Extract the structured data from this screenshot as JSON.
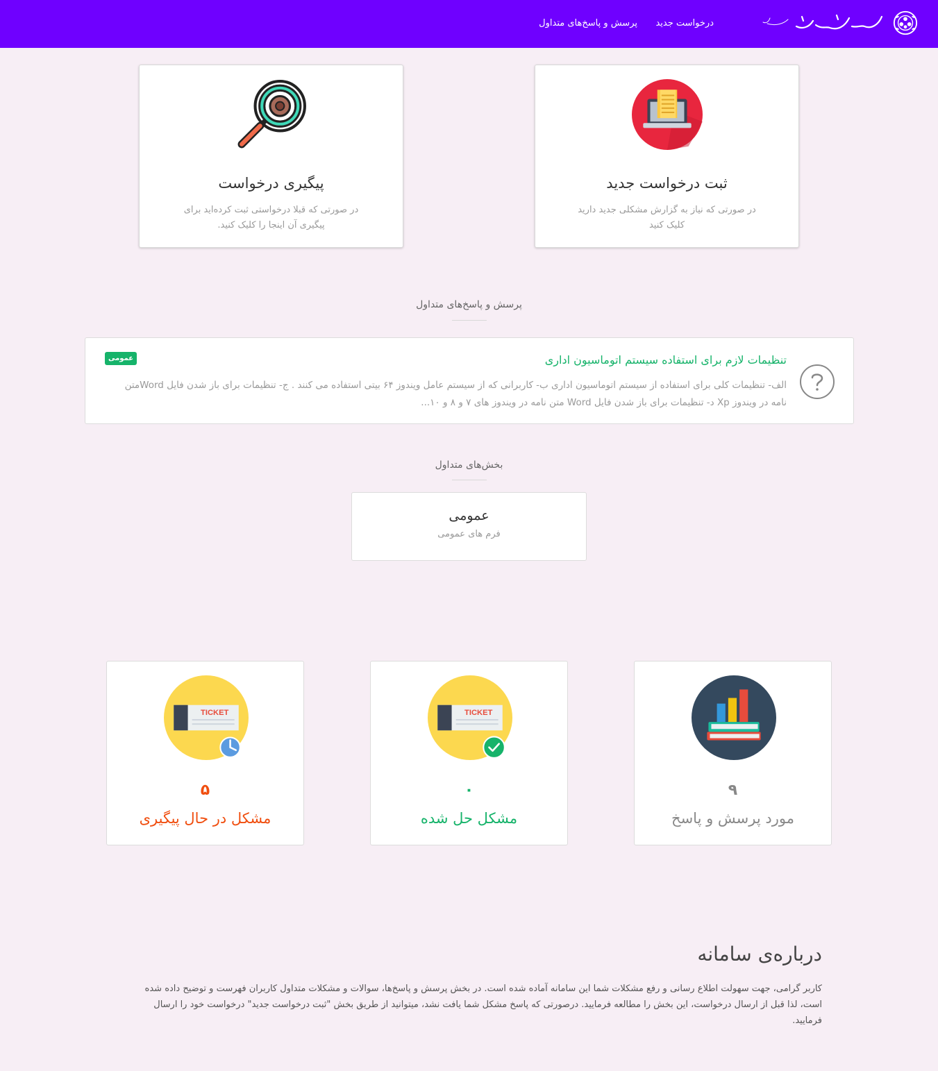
{
  "nav": {
    "links": [
      "درخواست جدید",
      "پرسش و پاسخ‌های متداول"
    ],
    "logo_alt": "دانشگاه صنعتی امیرکبیر"
  },
  "actions": {
    "new_request": {
      "title": "ثبت درخواست جدید",
      "desc": "در صورتی که نیاز به گزارش مشکلی جدید دارید کلیک کنید",
      "icon": "laptop-document-icon"
    },
    "track_request": {
      "title": "پیگیری درخواست",
      "desc": "در صورتی که قبلا درخواستی ثبت کرده‌اید برای پیگیری آن اینجا را کلیک کنید.",
      "icon": "magnifier-icon"
    }
  },
  "faq_section": {
    "heading": "پرسش و پاسخ‌های متداول",
    "items": [
      {
        "title": "تنظیمات لازم برای استفاده سیستم اتوماسیون اداری",
        "badge": "عمومی",
        "body": "الف- تنظیمات کلی برای استفاده از سیستم اتوماسیون اداری ب- کاربرانی که از سیستم عامل ویندوز ۶۴ بیتی استفاده می کنند . ج- تنظیمات برای باز شدن فایل Wordمتن نامه در ویندوز Xp د- تنظیمات برای باز شدن فایل Word متن نامه در ویندوز های ۷ و ۸ و ۱۰..."
      }
    ]
  },
  "sections": {
    "heading": "بخش‌های متداول",
    "items": [
      {
        "title": "عمومی",
        "subtitle": "فرم های عمومی"
      }
    ]
  },
  "stats": {
    "faq": {
      "count": "۹",
      "label": "مورد پرسش و پاسخ",
      "color": "#888888"
    },
    "solved": {
      "count": "۰",
      "label": "مشکل حل شده",
      "color": "#16b36a"
    },
    "pending": {
      "count": "۵",
      "label": "مشکل در حال پیگیری",
      "color": "#f04e0f"
    },
    "ticket_text": "TICKET"
  },
  "about": {
    "title": "درباره‌ی سامانه",
    "text": "کاربر گرامی، جهت سهولت اطلاع رسانی و رفع مشکلات شما این سامانه آماده شده است. در بخش پرسش و پاسخ‌ها، سوالات و مشکلات متداول کاربران فهرست و توضیح داده شده است، لذا قبل از ارسال درخواست، این بخش را مطالعه فرمایید. درصورتی که پاسخ مشکل شما یافت نشد، میتوانید از طریق بخش \"ثبت درخواست جدید\" درخواست خود را ارسال فرمایید."
  },
  "colors": {
    "navbar": "#6f00ff",
    "background": "#f7eef5",
    "accent_green": "#16b36a",
    "accent_orange": "#f04e0f"
  }
}
